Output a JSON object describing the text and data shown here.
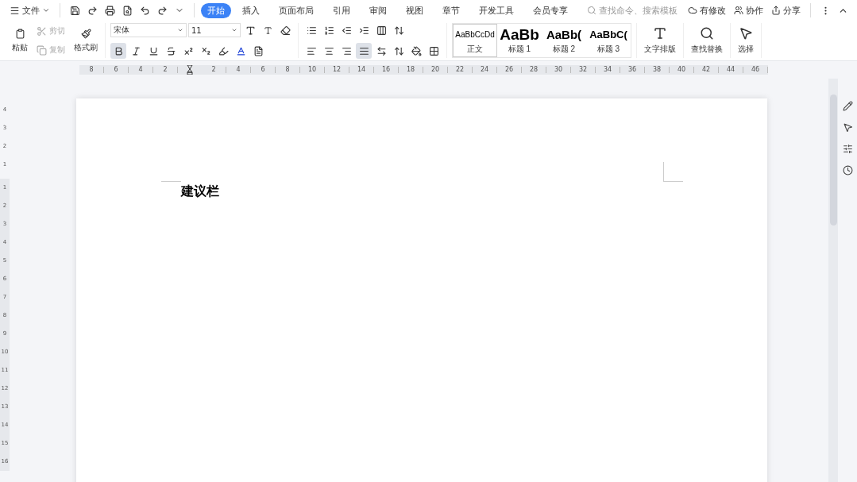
{
  "menu_bar": {
    "file_menu": "文件",
    "tabs": [
      {
        "label": "开始",
        "selected": true
      },
      {
        "label": "插入",
        "selected": false
      },
      {
        "label": "页面布局",
        "selected": false
      },
      {
        "label": "引用",
        "selected": false
      },
      {
        "label": "审阅",
        "selected": false
      },
      {
        "label": "视图",
        "selected": false
      },
      {
        "label": "章节",
        "selected": false
      },
      {
        "label": "开发工具",
        "selected": false
      },
      {
        "label": "会员专享",
        "selected": false
      }
    ],
    "search": {
      "placeholder": "查找命令、搜索模板"
    },
    "actions": [
      {
        "kind": "modified",
        "label": "有修改"
      },
      {
        "kind": "collab",
        "label": "协作"
      },
      {
        "kind": "share",
        "label": "分享"
      }
    ]
  },
  "ribbon": {
    "clipboard": [
      {
        "kind": "paste",
        "label": "粘贴",
        "disabled": false
      },
      {
        "kind": "cut",
        "label": "剪切",
        "disabled": true
      },
      {
        "kind": "copy",
        "label": "复制",
        "disabled": true
      },
      {
        "kind": "painter",
        "label": "格式刷",
        "disabled": false
      }
    ],
    "font": {
      "name": "宋体",
      "size": "11"
    },
    "format_buttons": [
      {
        "kind": "bold",
        "selected": true
      },
      {
        "kind": "italic",
        "selected": false
      },
      {
        "kind": "underline",
        "selected": false
      },
      {
        "kind": "strike",
        "selected": false
      },
      {
        "kind": "superscript",
        "selected": false
      },
      {
        "kind": "subscript",
        "selected": false
      }
    ],
    "align_buttons": [
      {
        "kind": "left",
        "selected": false
      },
      {
        "kind": "center",
        "selected": false
      },
      {
        "kind": "right",
        "selected": false
      },
      {
        "kind": "justify",
        "selected": true
      },
      {
        "kind": "distribute",
        "selected": false
      }
    ],
    "styles": [
      {
        "preview": "AaBbCcDd",
        "label": "正文",
        "kind": "body",
        "selected": true
      },
      {
        "preview": "AaBb",
        "label": "标题 1",
        "kind": "h1",
        "selected": false
      },
      {
        "preview": "AaBb(",
        "label": "标题 2",
        "kind": "h2",
        "selected": false
      },
      {
        "preview": "AaBbC(",
        "label": "标题 3",
        "kind": "h3",
        "selected": false
      }
    ],
    "tools": [
      {
        "kind": "layout",
        "label": "文字排版"
      },
      {
        "kind": "find",
        "label": "查找替换"
      },
      {
        "kind": "select",
        "label": "选择"
      }
    ]
  },
  "ruler": {
    "left_numbers": [
      "8",
      "6",
      "4",
      "2"
    ],
    "right_numbers": [
      "2",
      "4",
      "6",
      "8",
      "10",
      "12",
      "14",
      "16",
      "18",
      "20",
      "22",
      "24",
      "26",
      "28",
      "30",
      "32",
      "34",
      "36",
      "38",
      "40",
      "42",
      "44",
      "46"
    ],
    "top_numbers": [
      "4",
      "3",
      "2",
      "1"
    ],
    "body_numbers": [
      "1",
      "2",
      "3",
      "4",
      "5",
      "6",
      "7",
      "8",
      "9",
      "10",
      "11",
      "12",
      "13",
      "14",
      "15",
      "16"
    ]
  },
  "document": {
    "text": "建议栏"
  }
}
